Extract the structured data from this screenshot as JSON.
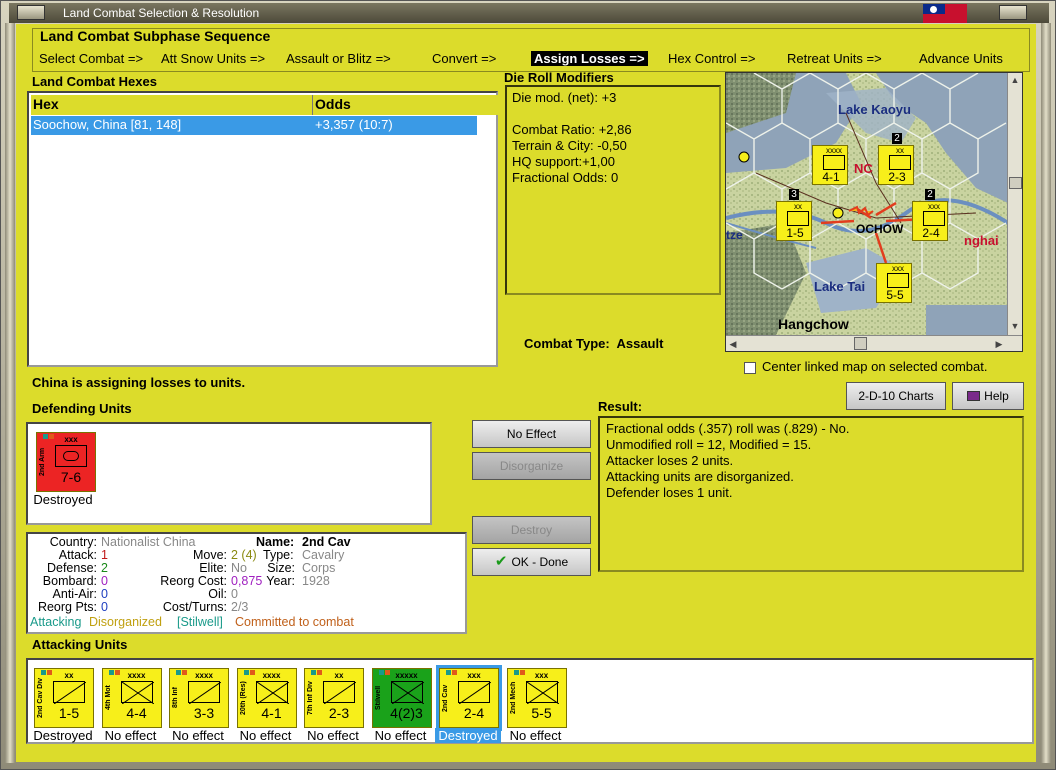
{
  "window": {
    "title": "Land Combat Selection & Resolution"
  },
  "subphase": {
    "title": "Land Combat Subphase Sequence",
    "steps": [
      {
        "label": "Select Combat =>"
      },
      {
        "label": "Att Snow Units =>"
      },
      {
        "label": "Assault or Blitz =>"
      },
      {
        "label": "Convert =>"
      },
      {
        "label": "Assign Losses =>",
        "active": true
      },
      {
        "label": "Hex Control =>"
      },
      {
        "label": "Retreat Units =>"
      },
      {
        "label": "Advance Units"
      }
    ]
  },
  "hexes": {
    "title": "Land Combat Hexes",
    "col_hex": "Hex",
    "col_odds": "Odds",
    "rows": [
      {
        "hex": "Soochow, China [81, 148]",
        "odds": "+3,357 (10:7)"
      }
    ]
  },
  "die_roll": {
    "title": "Die Roll Modifiers",
    "lines": [
      "Die mod. (net): +3",
      "",
      "Combat Ratio: +2,86",
      "Terrain & City: -0,50",
      "HQ support:+1,00",
      "Fractional Odds: 0"
    ]
  },
  "map": {
    "labels": {
      "lake1": "Lake Kaoyu",
      "lake2": "Lake Tai",
      "city1": "Hangchow",
      "city2": "OCHOW",
      "partial1": "tze",
      "partial2": "nghai",
      "partial3": "NC"
    },
    "units": [
      {
        "id": "u1",
        "size": "xxxx",
        "val": "4-1"
      },
      {
        "id": "u2",
        "size": "xx",
        "val": "2-3"
      },
      {
        "id": "u3",
        "size": "xx",
        "val": "1-5"
      },
      {
        "id": "u4",
        "size": "xxx",
        "val": "2-4"
      },
      {
        "id": "u5",
        "size": "xxx",
        "val": "5-5"
      }
    ],
    "stack_counts": {
      "a": "2",
      "b": "3",
      "c": "2"
    }
  },
  "combat_type": {
    "label": "Combat Type:",
    "value": "Assault"
  },
  "center_map": {
    "label": "Center linked map on selected combat.",
    "checked": false
  },
  "buttons": {
    "charts": "2-D-10 Charts",
    "help": "Help",
    "no_effect": "No Effect",
    "disorganize": "Disorganize",
    "destroy": "Destroy",
    "ok": "OK - Done"
  },
  "status_message": "China is assigning losses to units.",
  "defending": {
    "title": "Defending Units",
    "units": [
      {
        "name": "2nd Arm",
        "size": "xxx",
        "val": "7-6",
        "status": "Destroyed",
        "color": "#ec2424"
      }
    ]
  },
  "info": {
    "country_lbl": "Country:",
    "country": "Nationalist China",
    "name_lbl": "Name:",
    "name": "2nd Cav",
    "attack_lbl": "Attack:",
    "attack": "1",
    "move_lbl": "Move:",
    "move": "2 (4)",
    "type_lbl": "Type:",
    "type": "Cavalry",
    "defense_lbl": "Defense:",
    "defense": "2",
    "elite_lbl": "Elite:",
    "elite": "No",
    "size_lbl": "Size:",
    "size": "Corps",
    "bombard_lbl": "Bombard:",
    "bombard": "0",
    "reorg_cost_lbl": "Reorg Cost:",
    "reorg_cost": "0,875",
    "year_lbl": "Year:",
    "year": "1928",
    "antiair_lbl": "Anti-Air:",
    "antiair": "0",
    "oil_lbl": "Oil:",
    "oil": "0",
    "reorg_pts_lbl": "Reorg Pts:",
    "reorg_pts": "0",
    "cost_turns_lbl": "Cost/Turns:",
    "cost_turns": "2/3",
    "tag_attacking": "Attacking",
    "tag_disorganized": "Disorganized",
    "tag_stilwell": "[Stilwell]",
    "tag_committed": "Committed to combat"
  },
  "result": {
    "title": "Result:",
    "lines": [
      "Fractional odds (.357) roll was (.829)  - No.",
      "Unmodified roll = 12, Modified = 15.",
      "Attacker loses 2 units.",
      "Attacking units are disorganized.",
      "Defender loses 1 unit."
    ]
  },
  "attacking": {
    "title": "Attacking Units",
    "units": [
      {
        "name": "2nd Cav Div",
        "size": "xx",
        "val": "1-5",
        "status": "Destroyed",
        "color": "#f7ef1a"
      },
      {
        "name": "4th Mot",
        "size": "xxxx",
        "val": "4-4",
        "status": "No effect",
        "color": "#f7ef1a"
      },
      {
        "name": "8th Inf",
        "size": "xxxx",
        "val": "3-3",
        "status": "No effect",
        "color": "#f7ef1a"
      },
      {
        "name": "20th (Res)",
        "size": "xxxx",
        "val": "4-1",
        "status": "No effect",
        "color": "#f7ef1a"
      },
      {
        "name": "7th Inf Div",
        "size": "xx",
        "val": "2-3",
        "status": "No effect",
        "color": "#f7ef1a"
      },
      {
        "name": "Stilwell",
        "size": "xxxxx",
        "val": "4(2)3",
        "status": "No effect",
        "color": "#1aa21a"
      },
      {
        "name": "2nd Cav",
        "size": "xxx",
        "val": "2-4",
        "status": "Destroyed",
        "color": "#f7ef1a",
        "selected": true
      },
      {
        "name": "2nd Mech",
        "size": "xxx",
        "val": "5-5",
        "status": "No effect",
        "color": "#f7ef1a"
      }
    ]
  }
}
